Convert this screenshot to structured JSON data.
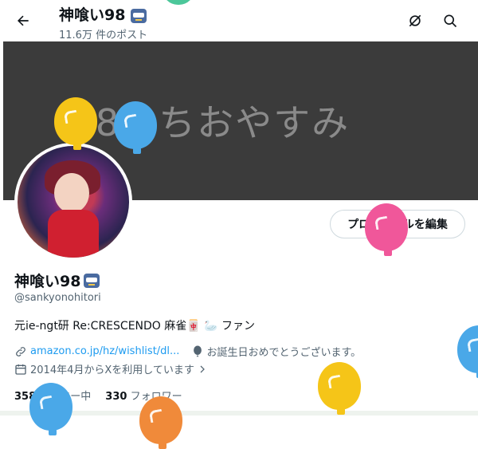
{
  "header": {
    "title": "神喰い98",
    "subtitle": "11.6万 件のポスト"
  },
  "banner": {
    "text": "-98っちおやすみ"
  },
  "profile": {
    "edit_button": "プロフィールを編集",
    "name": "神喰い98",
    "handle": "@sankyonohitori",
    "bio": "元ie-ngt研 Re:CRESCENDO 麻雀🀄 🦢 ファン",
    "link": "amazon.co.jp/hz/wishlist/dl...",
    "birthday": "お誕生日おめでとうございます。",
    "joined": "2014年4月からXを利用しています",
    "following_count": "358",
    "following_label": "フォロー中",
    "followers_count": "330",
    "followers_label": "フォロワー"
  },
  "colors": {
    "accent": "#1d9bf0",
    "balloon_yellow": "#f5c518",
    "balloon_blue": "#4aa8e8",
    "balloon_pink": "#f0579a",
    "balloon_orange": "#f08a3a"
  },
  "icons": {
    "back": "arrow-left-icon",
    "grok": "grok-icon",
    "search": "search-icon",
    "link": "link-icon",
    "balloon": "balloon-icon",
    "calendar": "calendar-icon",
    "chevron": "chevron-right-icon"
  }
}
